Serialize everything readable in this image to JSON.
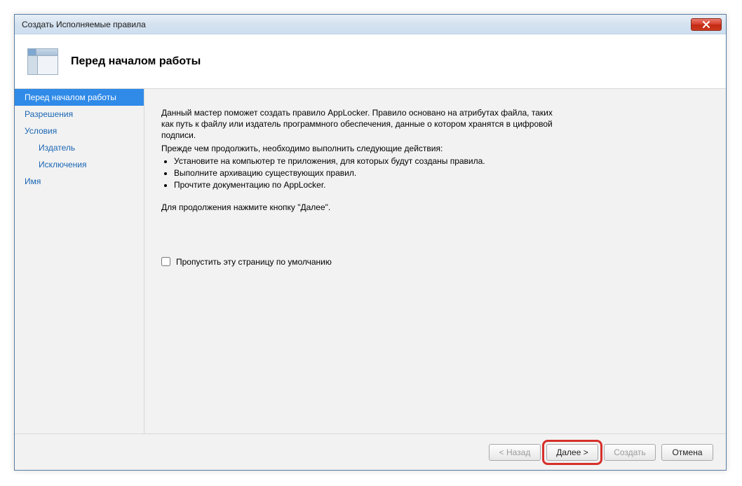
{
  "window": {
    "title": "Создать Исполняемые правила"
  },
  "header": {
    "title": "Перед началом работы"
  },
  "sidebar": {
    "items": [
      {
        "label": "Перед началом работы",
        "active": true,
        "sub": false
      },
      {
        "label": "Разрешения",
        "active": false,
        "sub": false
      },
      {
        "label": "Условия",
        "active": false,
        "sub": false
      },
      {
        "label": "Издатель",
        "active": false,
        "sub": true
      },
      {
        "label": "Исключения",
        "active": false,
        "sub": true
      },
      {
        "label": "Имя",
        "active": false,
        "sub": false
      }
    ]
  },
  "content": {
    "p1": "Данный мастер поможет создать правило AppLocker. Правило основано на атрибутах файла, таких как путь к файлу или издатель программного обеспечения, данные о котором хранятся в цифровой подписи.",
    "p2": "Прежде чем продолжить, необходимо выполнить следующие действия:",
    "bullets": [
      "Установите на компьютер те приложения, для которых будут созданы правила.",
      "Выполните архивацию существующих правил.",
      "Прочтите документацию по AppLocker."
    ],
    "p3": "Для продолжения нажмите кнопку \"Далее\".",
    "skip_label": "Пропустить эту страницу по умолчанию"
  },
  "footer": {
    "back": "< Назад",
    "next": "Далее >",
    "create": "Создать",
    "cancel": "Отмена"
  }
}
